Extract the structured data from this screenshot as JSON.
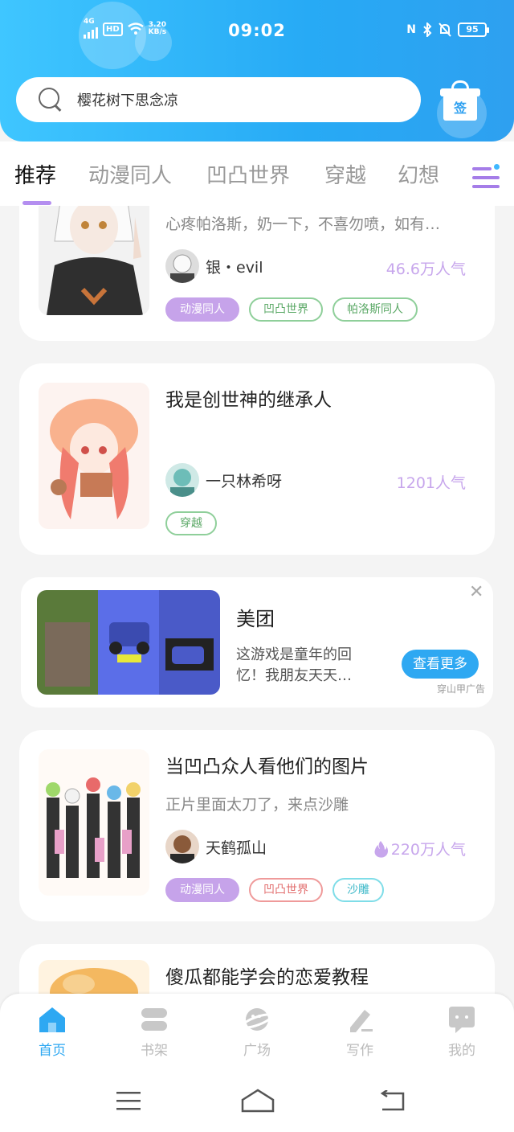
{
  "status": {
    "time": "09:02",
    "network": "4G",
    "hd": "HD",
    "speed_value": "3.20",
    "speed_unit": "KB/s",
    "battery": "95"
  },
  "search": {
    "query": "樱花树下思念凉"
  },
  "checkin": {
    "label": "签"
  },
  "tabs": [
    {
      "label": "推荐"
    },
    {
      "label": "动漫同人"
    },
    {
      "label": "凹凸世界"
    },
    {
      "label": "穿越"
    },
    {
      "label": "幻想"
    }
  ],
  "cards": [
    {
      "title": "",
      "desc": "心疼帕洛斯，奶一下，不喜勿喷，如有…",
      "author": "银・evil",
      "popularity": "46.6万人气",
      "tags": [
        "动漫同人",
        "凹凸世界",
        "帕洛斯同人"
      ]
    },
    {
      "title": "我是创世神的继承人",
      "author": "一只林希呀",
      "popularity": "1201人气",
      "tags": [
        "穿越"
      ]
    },
    {
      "title": "当凹凸众人看他们的图片",
      "desc": "正片里面太刀了，来点沙雕",
      "author": "天鹤孤山",
      "popularity": "220万人气",
      "tags": [
        "动漫同人",
        "凹凸世界",
        "沙雕"
      ]
    },
    {
      "title": "傻瓜都能学会的恋爱教程"
    }
  ],
  "ad": {
    "title": "美团",
    "desc": "这游戏是童年的回忆！我朋友天天…",
    "button": "查看更多",
    "source": "穿山甲广告",
    "close": "✕"
  },
  "bottom_nav": [
    {
      "label": "首页"
    },
    {
      "label": "书架"
    },
    {
      "label": "广场"
    },
    {
      "label": "写作"
    },
    {
      "label": "我的"
    }
  ],
  "colors": {
    "accent": "#2ea8f2",
    "tab_indicator": "#b48ef0",
    "popularity": "#c7a6ec"
  }
}
